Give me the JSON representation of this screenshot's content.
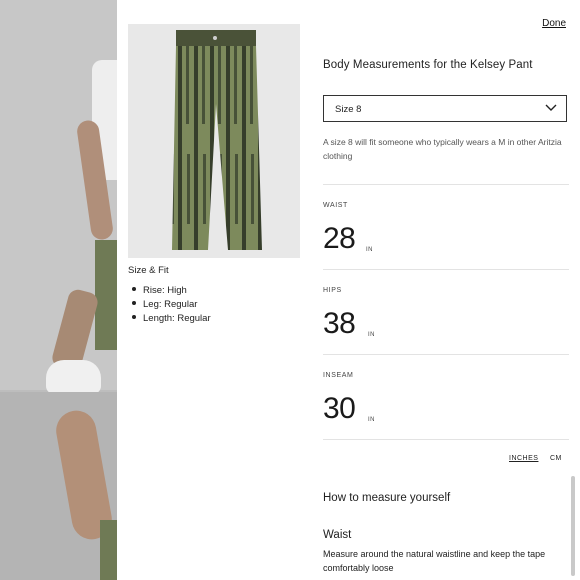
{
  "modal": {
    "done_label": "Done",
    "title": "Body Measurements for the Kelsey Pant",
    "size_select": {
      "selected": "Size 8"
    },
    "fit_note": "A size 8 will fit someone who typically wears a M in other Aritzia clothing",
    "measurements": [
      {
        "label": "WAIST",
        "value": "28",
        "unit": "IN"
      },
      {
        "label": "HIPS",
        "value": "38",
        "unit": "IN"
      },
      {
        "label": "INSEAM",
        "value": "30",
        "unit": "IN"
      }
    ],
    "unit_toggle": {
      "inches": "INCHES",
      "cm": "CM"
    },
    "how_to": {
      "title": "How to measure yourself",
      "waist_heading": "Waist",
      "waist_text": "Measure around the natural waistline and keep the tape comfortably loose"
    }
  },
  "product": {
    "size_fit_title": "Size & Fit",
    "fit_items": [
      "Rise: High",
      "Leg: Regular",
      "Length: Regular"
    ]
  },
  "icons": {
    "select_chevron": "chevron-down-icon"
  },
  "colors": {
    "pant_green": "#7d8a5c",
    "pant_dark": "#2f3526"
  }
}
